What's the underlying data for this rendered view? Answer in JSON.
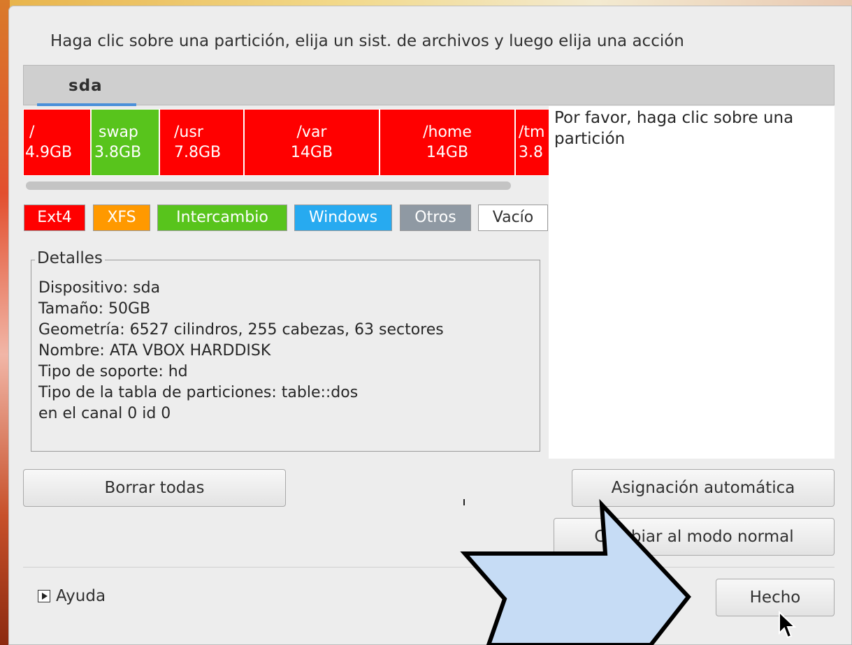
{
  "instructions": "Haga clic sobre una partición, elija un sist. de archivos y luego elija una acción",
  "tabs": [
    {
      "label": "sda"
    }
  ],
  "partitions": [
    {
      "mount": "/",
      "size": "4.9GB",
      "color": "#ff0000"
    },
    {
      "mount": "swap",
      "size": "3.8GB",
      "color": "#58c41c"
    },
    {
      "mount": "/usr",
      "size": "7.8GB",
      "color": "#ff0000"
    },
    {
      "mount": "/var",
      "size": "14GB",
      "color": "#ff0000"
    },
    {
      "mount": "/home",
      "size": "14GB",
      "color": "#ff0000"
    },
    {
      "mount": "/tm",
      "size": "3.8",
      "color": "#ff0000"
    }
  ],
  "legend": [
    {
      "label": "Ext4",
      "color": "#ff0000"
    },
    {
      "label": "XFS",
      "color": "#ff9900"
    },
    {
      "label": "Intercambio",
      "color": "#58c41c"
    },
    {
      "label": "Windows",
      "color": "#27aaf0"
    },
    {
      "label": "Otros",
      "color": "#8f99a3"
    },
    {
      "label": "Vacío",
      "color": "#ffffff"
    }
  ],
  "details": {
    "title": "Detalles",
    "lines": [
      "Dispositivo: sda",
      "Tamaño: 50GB",
      "Geometría: 6527 cilindros, 255 cabezas, 63 sectores",
      "Nombre: ATA VBOX HARDDISK",
      "Tipo de soporte: hd",
      "Tipo de la tabla de particiones: table::dos",
      "en el canal 0 id 0"
    ]
  },
  "side_message": "Por favor, haga clic sobre una partición",
  "buttons": {
    "clear_all": "Borrar todas",
    "auto_allocate": "Asignación automática",
    "normal_mode": "Cambiar al modo normal",
    "done": "Hecho"
  },
  "help": {
    "label": "Ayuda",
    "icon": "expander-triangle-icon"
  }
}
